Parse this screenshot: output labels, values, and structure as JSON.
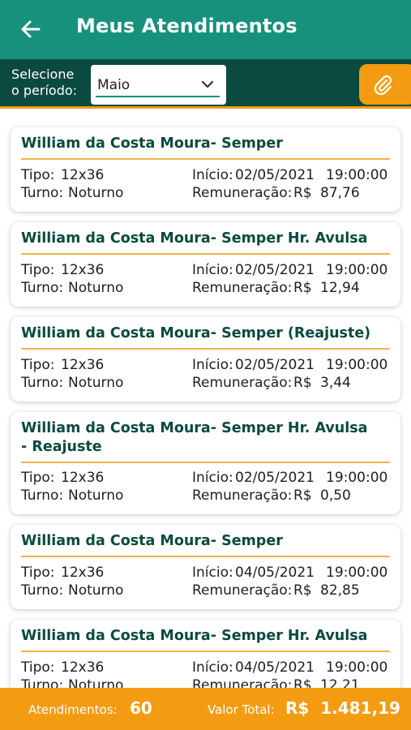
{
  "header": {
    "title": "Meus Atendimentos"
  },
  "filter": {
    "label_line1": "Selecione",
    "label_line2": "o período:",
    "selected_period": "Maio"
  },
  "labels": {
    "tipo": "Tipo:",
    "turno": "Turno:",
    "inicio": "Início:",
    "remuneracao": "Remuneração:"
  },
  "records": [
    {
      "title": "William da Costa Moura- Semper",
      "tipo": "12x36",
      "turno": "Noturno",
      "inicio_date": "02/05/2021",
      "inicio_time": "19:00:00",
      "currency": "R$",
      "amount": "87,76"
    },
    {
      "title": "William da Costa Moura- Semper  Hr. Avulsa",
      "tipo": "12x36",
      "turno": "Noturno",
      "inicio_date": "02/05/2021",
      "inicio_time": "19:00:00",
      "currency": "R$",
      "amount": "12,94"
    },
    {
      "title": "William da Costa Moura- Semper (Reajuste)",
      "tipo": "12x36",
      "turno": "Noturno",
      "inicio_date": "02/05/2021",
      "inicio_time": "19:00:00",
      "currency": "R$",
      "amount": "3,44"
    },
    {
      "title": "William da Costa Moura- Semper Hr. Avulsa - Reajuste",
      "tipo": "12x36",
      "turno": "Noturno",
      "inicio_date": "02/05/2021",
      "inicio_time": "19:00:00",
      "currency": "R$",
      "amount": "0,50"
    },
    {
      "title": "William da Costa Moura- Semper",
      "tipo": "12x36",
      "turno": "Noturno",
      "inicio_date": "04/05/2021",
      "inicio_time": "19:00:00",
      "currency": "R$",
      "amount": "82,85"
    },
    {
      "title": "William da Costa Moura- Semper  Hr. Avulsa",
      "tipo": "12x36",
      "turno": "Noturno",
      "inicio_date": "04/05/2021",
      "inicio_time": "19:00:00",
      "currency": "R$",
      "amount": "12,21"
    }
  ],
  "footer": {
    "count_label": "Atendimentos:",
    "count_value": "60",
    "total_label": "Valor Total:",
    "total_value": "R$  1.481,19"
  },
  "colors": {
    "primary": "#17917c",
    "dark": "#0b4a3f",
    "accent": "#f39c12"
  },
  "icons": {
    "back": "arrow-left-icon",
    "dropdown": "chevron-down-icon",
    "attach": "paperclip-icon"
  }
}
